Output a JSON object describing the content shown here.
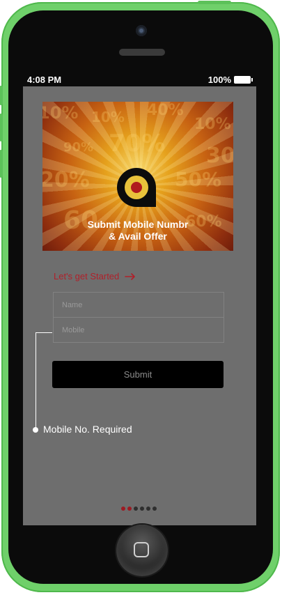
{
  "statusbar": {
    "time": "4:08 PM",
    "battery": "100%"
  },
  "banner": {
    "title_line1": "Submit Mobile Numbr",
    "title_line2": "& Avail Offer"
  },
  "form": {
    "heading": "Let's get Started",
    "name_placeholder": "Name",
    "mobile_placeholder": "Mobile",
    "submit_label": "Submit"
  },
  "callout": {
    "text": "Mobile No. Required"
  },
  "pager": {
    "total": 6,
    "active_indices": [
      0,
      1
    ]
  },
  "colors": {
    "accent": "#b0202a",
    "phone_body": "#6fd06a"
  }
}
